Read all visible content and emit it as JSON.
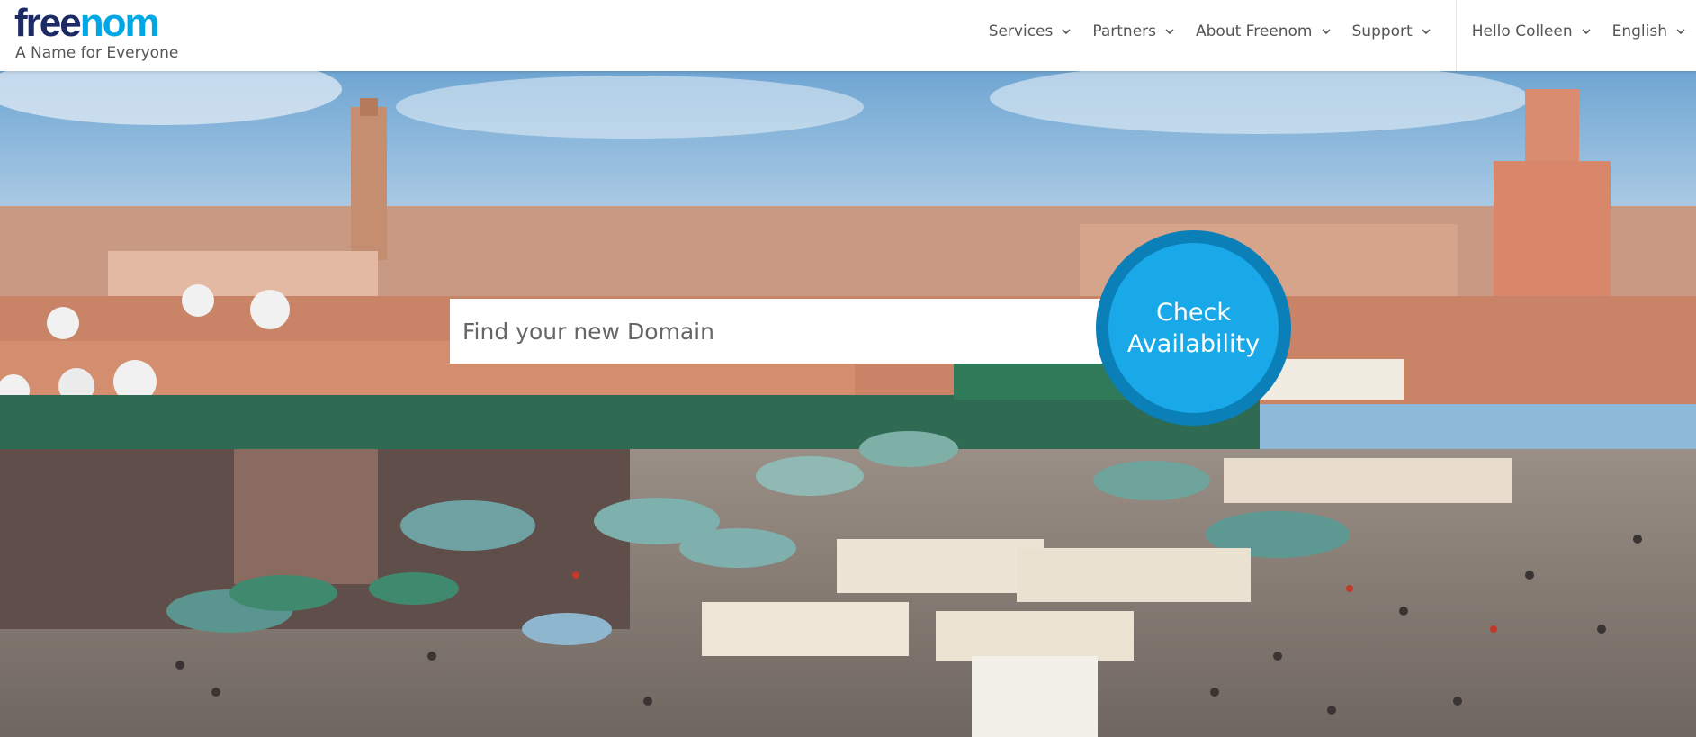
{
  "logo": {
    "brand_part1": "free",
    "brand_part2": "nom",
    "tagline": "A Name for Everyone"
  },
  "nav": {
    "items": [
      {
        "label": "Services"
      },
      {
        "label": "Partners"
      },
      {
        "label": "About Freenom"
      },
      {
        "label": "Support"
      }
    ],
    "user": {
      "label": "Hello Colleen"
    },
    "language": {
      "label": "English"
    }
  },
  "search": {
    "placeholder": "Find your new Domain",
    "value": ""
  },
  "check_button": {
    "line1": "Check",
    "line2": "Availability"
  },
  "colors": {
    "brand_dark": "#1c2a66",
    "brand_accent": "#00a7e5",
    "button_outer": "#0a7fb8",
    "button_inner": "#1aa9e8"
  }
}
